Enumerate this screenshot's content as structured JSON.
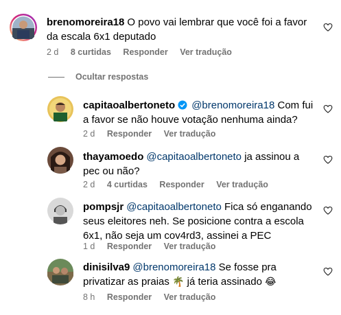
{
  "thread": {
    "hide_label": "Ocultar respostas",
    "actions": {
      "reply": "Responder",
      "translate": "Ver tradução"
    },
    "comments": [
      {
        "username": "brenomoreira18",
        "text": "O povo vai lembrar que você foi a favor da escala 6x1 deputado",
        "time": "2 d",
        "likes": "8 curtidas"
      },
      {
        "username": "capitaoalbertoneto",
        "verified": true,
        "mention": "@brenomoreira18",
        "text": "Com fui a favor se não houve votação nenhuma ainda?",
        "time": "2 d"
      },
      {
        "username": "thayamoedo",
        "mention": "@capitaoalbertoneto",
        "text": "ja assinou a pec ou não?",
        "time": "2 d",
        "likes": "4 curtidas"
      },
      {
        "username": "pompsjr",
        "mention": "@capitaoalbertoneto",
        "text": "Fica só enganando seus eleitores neh. Se posicione contra a escola 6x1, não seja um cov4rd3, assinei a PEC",
        "time": "1 d"
      },
      {
        "username": "dinisilva9",
        "mention": "@brenomoreira18",
        "text_before": "Se fosse pra privatizar as praias",
        "emoji1": "🌴",
        "text_middle": "já teria assinado",
        "emoji2": "😂",
        "time": "8 h"
      }
    ]
  },
  "colors": {
    "meta": "#737373",
    "mention": "#00376b",
    "verified": "#0095f6"
  }
}
